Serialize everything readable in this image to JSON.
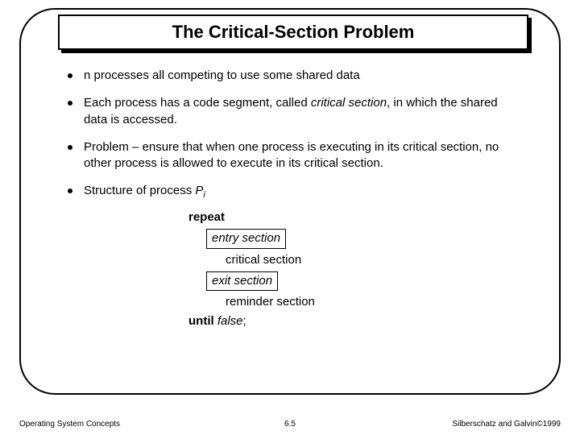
{
  "title": "The Critical-Section Problem",
  "bullets": {
    "b1": "n processes all competing to use some shared data",
    "b2_a": "Each process has a code segment, called ",
    "b2_em": "critical section",
    "b2_b": ", in which the shared data is accessed.",
    "b3": "Problem – ensure that when one process is executing in its critical section, no other process is allowed to execute in its critical section.",
    "b4_a": "Structure of process ",
    "b4_p": "P",
    "b4_i": "i"
  },
  "structure": {
    "repeat": "repeat",
    "entry": "entry section",
    "critical": "critical section",
    "exit": "exit section",
    "reminder": "reminder section",
    "until": "until",
    "false": " false",
    "semi": ";"
  },
  "footer": {
    "left": "Operating System Concepts",
    "center": "6.5",
    "right": "Silberschatz and Galvin©1999"
  }
}
